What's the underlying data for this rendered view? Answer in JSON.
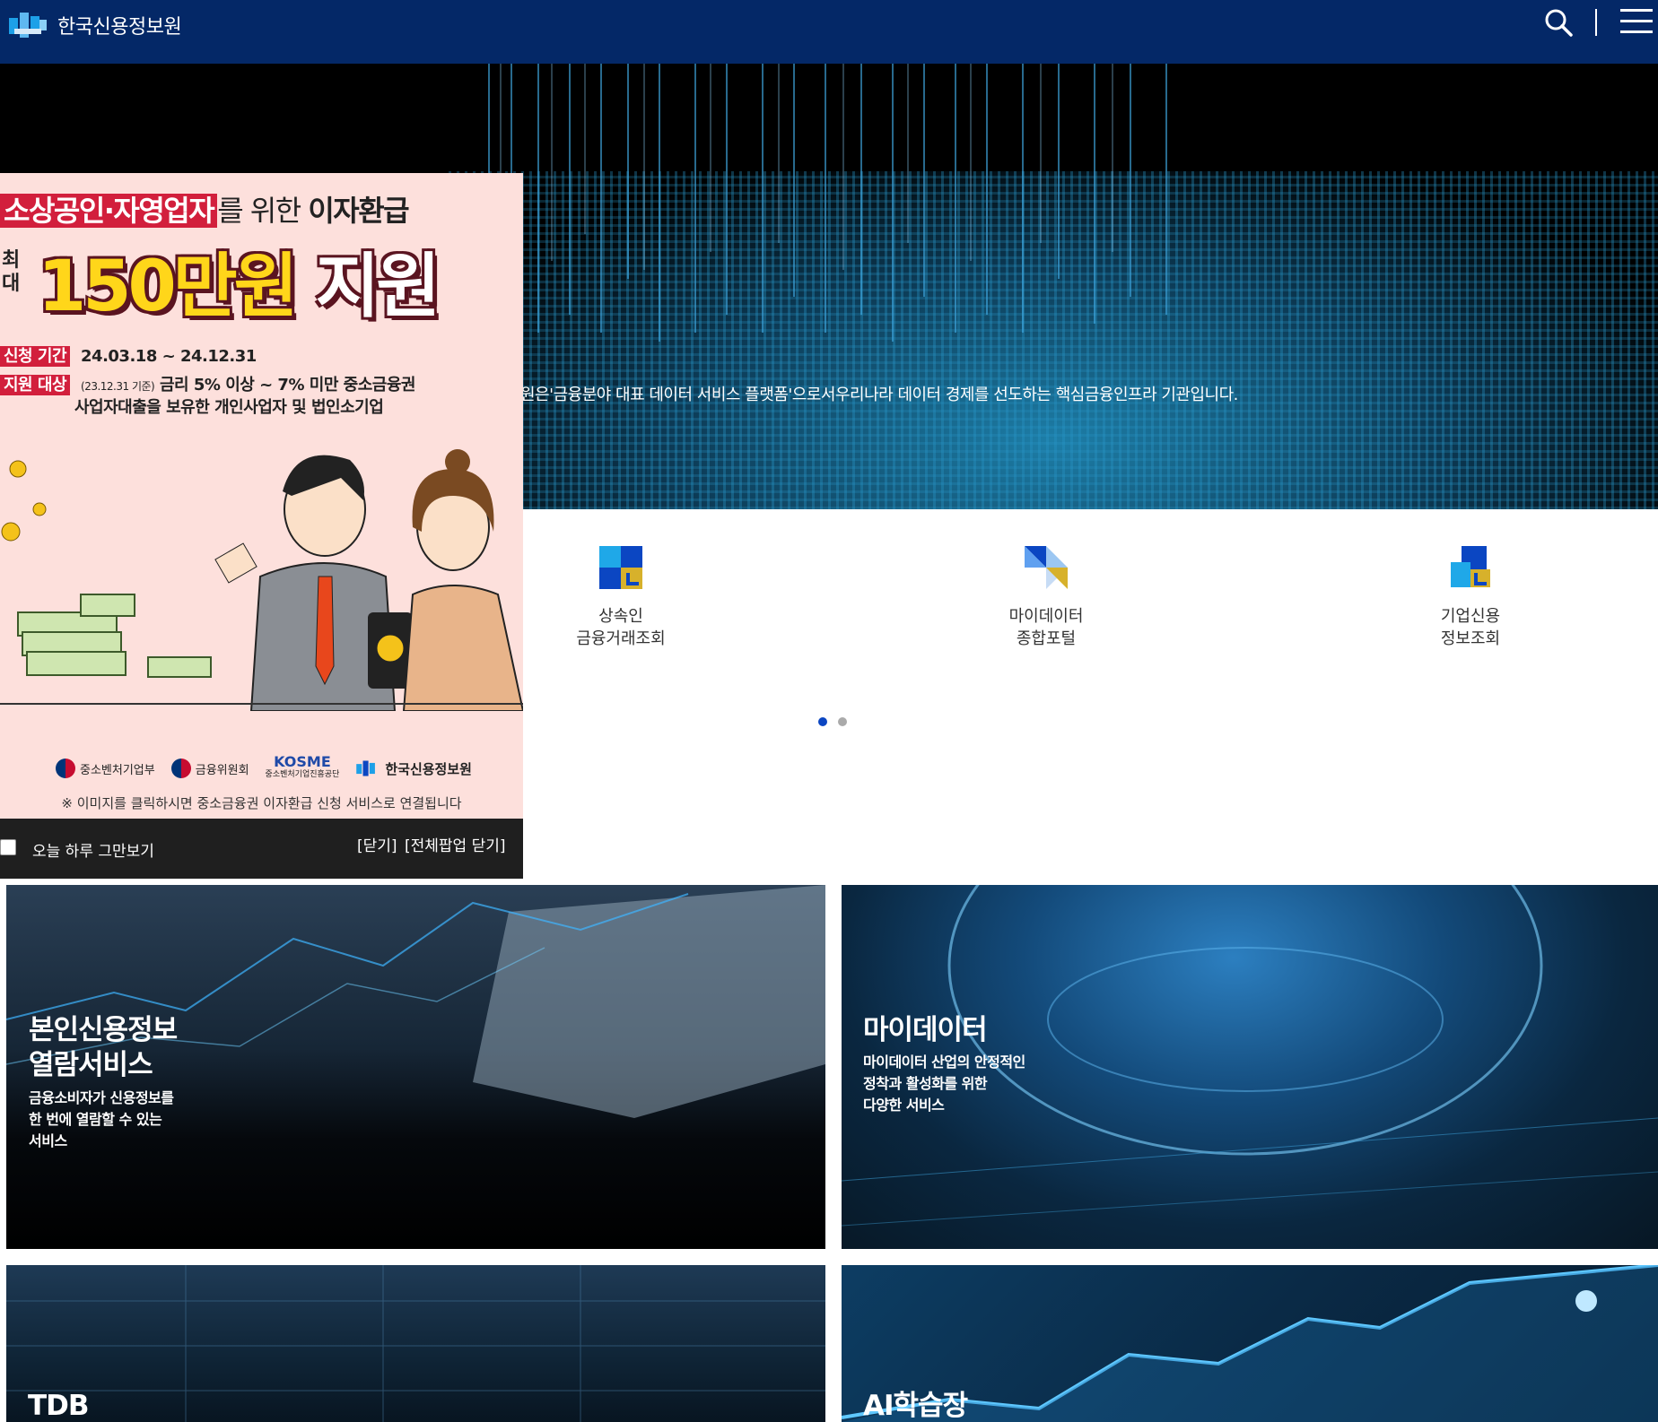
{
  "header": {
    "logo_text": "한국신용정보원",
    "logo_icon": "kcis-logo-icon",
    "search_icon": "search-icon",
    "menu_icon": "hamburger-menu-icon"
  },
  "hero": {
    "tagline": "원은'금융분야 대표 데이터 서비스 플랫폼'으로서우리나라 데이터 경제를 선도하는 핵심금융인프라 기관입니다."
  },
  "quick_services": [
    {
      "line1": "상속인",
      "line2": "금융거래조회",
      "icon": "inheritance-finance-icon"
    },
    {
      "line1": "마이데이터",
      "line2": "종합포털",
      "icon": "mydata-portal-icon"
    },
    {
      "line1": "기업신용",
      "line2": "정보조회",
      "icon": "corporate-credit-icon"
    }
  ],
  "carousel": {
    "pages": 2,
    "active": 1
  },
  "cards": [
    {
      "title": "본인신용정보\n열람서비스",
      "desc": "금융소비자가 신용정보를\n한 번에 열람할 수 있는\n서비스"
    },
    {
      "title": "마이데이터",
      "desc": "마이데이터 산업의 안정적인\n정착과 활성화를 위한\n다양한 서비스"
    },
    {
      "title": "TDB",
      "desc": ""
    },
    {
      "title": "AI학습장",
      "desc": ""
    }
  ],
  "popup": {
    "headline_highlight": "소상공인·자영업자",
    "headline_mid": "를 위한 ",
    "headline_end": "이자환급",
    "max_label": "최대",
    "amount_part1": "150만원",
    "amount_part2": " 지원",
    "period_tag": "신청 기간",
    "period_value": "24.03.18 ~ 24.12.31",
    "target_tag": "지원 대상",
    "target_note": "(23.12.31 기준)",
    "target_value": " 금리 5% 이상 ~ 7% 미만 중소금융권",
    "target_value2": "사업자대출을 보유한 개인사업자 및 법인소기업",
    "logo1": "중소벤처기업부",
    "logo2": "금융위원회",
    "logo3": "KOSME",
    "logo3_sub": "중소벤처기업진흥공단",
    "logo4": "한국신용정보원",
    "note": "※ 이미지를 클릭하시면 중소금융권 이자환급 신청 서비스로 연결됩니다",
    "today_label": "오늘 하루 그만보기",
    "close_label": "[닫기]",
    "close_all_label": "[전체팝업 닫기]"
  }
}
